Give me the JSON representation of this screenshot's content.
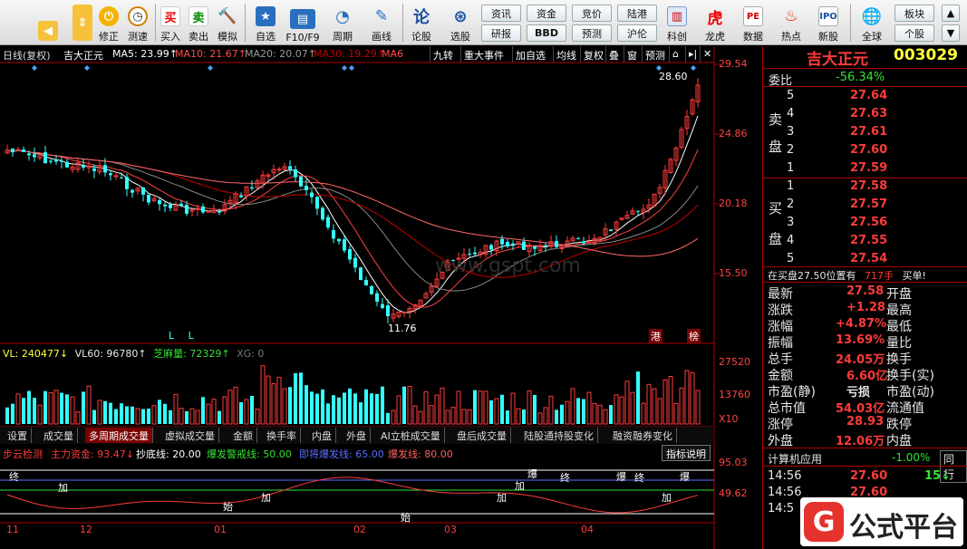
{
  "toolbar": {
    "buttons": [
      {
        "label": "",
        "icon": "back-arrow-icon"
      },
      {
        "label": "",
        "icon": "up-down-icon"
      },
      {
        "label": "修正",
        "icon": "power-icon"
      },
      {
        "label": "测速",
        "icon": "clock-icon"
      },
      {
        "label": "买入",
        "icon": "buy-icon",
        "glyph": "买"
      },
      {
        "label": "卖出",
        "icon": "sell-icon",
        "glyph": "卖"
      },
      {
        "label": "模拟",
        "icon": "hammer-icon"
      },
      {
        "label": "自选",
        "icon": "star-folder-icon"
      },
      {
        "label": "F10/F9",
        "icon": "f10-icon"
      },
      {
        "label": "周期",
        "icon": "period-clock-icon"
      },
      {
        "label": "画线",
        "icon": "pencil-icon"
      },
      {
        "label": "论股",
        "icon": "discuss-icon",
        "glyph": "论"
      },
      {
        "label": "选股",
        "icon": "select-stock-icon"
      }
    ],
    "small_buttons": [
      "资讯",
      "资金",
      "竞价",
      "陆港",
      "研报",
      "BBD",
      "预测",
      "沪伦"
    ],
    "right_buttons": [
      {
        "label": "K线图",
        "icon": "kline-icon"
      },
      {
        "label": "龙虎",
        "icon": "tiger-icon",
        "glyph": "虎"
      },
      {
        "label": "数据",
        "icon": "pe-icon",
        "glyph": "PE"
      },
      {
        "label": "热点",
        "icon": "fire-icon"
      },
      {
        "label": "新股",
        "icon": "ipo-icon"
      },
      {
        "label": "全球",
        "icon": "globe-icon"
      }
    ],
    "tail_buttons": [
      "板块",
      "个股"
    ]
  },
  "chart_header": {
    "period": "日线(复权)",
    "stock": "吉大正元",
    "ma5": "MA5: 23.99↑",
    "ma10": "MA10: 21.67↑",
    "ma20": "MA20: 20.07↑",
    "ma30": "MA30: 19.29↑",
    "ma6": "MA6",
    "buttons": [
      "九转",
      "重大事件",
      "加自选",
      "均线",
      "复权",
      "叠",
      "窗",
      "预测"
    ]
  },
  "price_axis": [
    "29.54",
    "24.86",
    "20.18",
    "15.50"
  ],
  "price_marks": {
    "high": "28.60",
    "low": "11.76",
    "low_tags": "L L",
    "tag1": "港",
    "tag2": "榜"
  },
  "vol_header": {
    "vl": "VL: 240477↓",
    "vl60": "VL60: 96780↑",
    "zhima": "芝麻量: 72329↑",
    "xg": "XG: 0"
  },
  "vol_axis": [
    "27520",
    "13760",
    "X10"
  ],
  "tabs": [
    "设置",
    "成交量",
    "多周期成交量",
    "虚拟成交量",
    "金额",
    "换手率",
    "内盘",
    "外盘",
    "AI立桩成交量",
    "盘后成交量",
    "陆股通持股变化",
    "融资融券变化"
  ],
  "active_tab": "多周期成交量",
  "indicator_header": {
    "name": "步云检测",
    "zhuli": "主力资金: 93.47↓",
    "chaodi": "抄底线: 20.00",
    "warn": "爆发警戒线: 50.00",
    "jijiang": "即将爆发线: 65.00",
    "baofa": "爆发线: 80.00",
    "help": "指标说明"
  },
  "ind_axis": [
    "95.03",
    "49.62"
  ],
  "ind_tags": [
    "终",
    "加",
    "加",
    "始",
    "始",
    "加",
    "加",
    "爆",
    "终",
    "爆",
    "终",
    "加",
    "爆"
  ],
  "date_axis": [
    "11",
    "12",
    "01",
    "02",
    "03",
    "04"
  ],
  "watermark": "www.gspt.com",
  "quote": {
    "name": "吉大正元",
    "code": "003029",
    "weibi_label": "委比",
    "weibi": "-56.34%",
    "sell_label_1": "卖",
    "sell_label_2": "盘",
    "buy_label_1": "买",
    "buy_label_2": "盘",
    "sell": [
      {
        "n": "5",
        "p": "27.64"
      },
      {
        "n": "4",
        "p": "27.63"
      },
      {
        "n": "3",
        "p": "27.61"
      },
      {
        "n": "2",
        "p": "27.60"
      },
      {
        "n": "1",
        "p": "27.59"
      }
    ],
    "buy": [
      {
        "n": "1",
        "p": "27.58"
      },
      {
        "n": "2",
        "p": "27.57"
      },
      {
        "n": "3",
        "p": "27.56"
      },
      {
        "n": "4",
        "p": "27.55"
      },
      {
        "n": "5",
        "p": "27.54"
      }
    ],
    "notice": "在买盘27.50位置有",
    "notice_qty": "717手",
    "notice_tail": "买单!",
    "stats": [
      {
        "l": "最新",
        "v": "27.58",
        "l2": "开盘"
      },
      {
        "l": "涨跌",
        "v": "+1.28",
        "l2": "最高"
      },
      {
        "l": "涨幅",
        "v": "+4.87%",
        "l2": "最低"
      },
      {
        "l": "振幅",
        "v": "13.69%",
        "l2": "量比"
      },
      {
        "l": "总手",
        "v": "24.05万",
        "l2": "换手"
      },
      {
        "l": "金额",
        "v": "6.60亿",
        "l2": "换手(实)"
      },
      {
        "l": "市盈(静)",
        "v": "亏损",
        "l2": "市盈(动)"
      },
      {
        "l": "总市值",
        "v": "54.03亿",
        "l2": "流通值"
      },
      {
        "l": "涨停",
        "v": "28.93",
        "l2": "跌停"
      },
      {
        "l": "外盘",
        "v": "12.06万",
        "l2": "内盘"
      }
    ],
    "industry": "计算机应用",
    "industry_pct": "-1.00%",
    "industry_tail": "同行",
    "ticks": [
      {
        "t": "14:56",
        "p": "27.60",
        "v": "15"
      },
      {
        "t": "14:56",
        "p": "27.60"
      },
      {
        "t": "14:5",
        "p": ""
      }
    ]
  },
  "logo": {
    "text": "公式平台"
  },
  "colors": {
    "up": "#ff3b3b",
    "down": "#3ff",
    "ma5": "#ffffff",
    "ma10": "#ff4444",
    "ma20": "#b00000",
    "ma30": "#ff6a6a"
  }
}
